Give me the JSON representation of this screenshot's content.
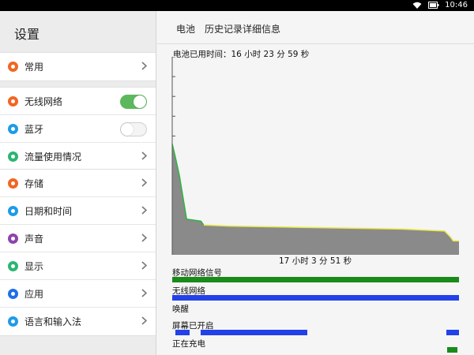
{
  "status_bar": {
    "time": "10:46",
    "icons": [
      "wifi-icon",
      "battery-icon"
    ]
  },
  "settings": {
    "title": "设置",
    "groups": [
      [
        {
          "label": "常用",
          "icon": "gear-icon",
          "color": "#f26522",
          "control": "chevron"
        }
      ],
      [
        {
          "label": "无线网络",
          "icon": "wifi-icon",
          "color": "#f26522",
          "control": "toggle",
          "state": "on"
        },
        {
          "label": "蓝牙",
          "icon": "bluetooth-icon",
          "color": "#1e9be8",
          "control": "toggle",
          "state": "off"
        },
        {
          "label": "流量使用情况",
          "icon": "data-usage-icon",
          "color": "#2bb673",
          "control": "chevron"
        }
      ],
      [
        {
          "label": "存储",
          "icon": "storage-icon",
          "color": "#f26522",
          "control": "chevron"
        },
        {
          "label": "日期和时间",
          "icon": "clock-icon",
          "color": "#1e9be8",
          "control": "chevron"
        },
        {
          "label": "声音",
          "icon": "sound-icon",
          "color": "#8e44ad",
          "control": "chevron"
        },
        {
          "label": "显示",
          "icon": "display-icon",
          "color": "#2bb673",
          "control": "chevron"
        },
        {
          "label": "应用",
          "icon": "apps-icon",
          "color": "#1e6fe8",
          "control": "chevron"
        },
        {
          "label": "语言和输入法",
          "icon": "language-icon",
          "color": "#1e9be8",
          "control": "chevron"
        }
      ]
    ]
  },
  "detail": {
    "breadcrumb_root": "电池",
    "breadcrumb_title": "历史记录详细信息",
    "battery_time_label": "电池已用时间：16 小时 23 分 59 秒",
    "total_time_label": "17 小时 3 分 51 秒",
    "rows": [
      {
        "label": "移动网络信号",
        "color": "#1a8a1a",
        "segments": [
          [
            0,
            1
          ]
        ]
      },
      {
        "label": "无线网络",
        "color": "#2341e8",
        "segments": [
          [
            0,
            1
          ]
        ]
      },
      {
        "label": "唤醒",
        "color": "#2341e8",
        "segments": []
      },
      {
        "label": "屏幕已开启",
        "color": "#2341e8",
        "segments": [
          [
            0.01,
            0.06
          ],
          [
            0.1,
            0.47
          ],
          [
            0.955,
            1
          ]
        ]
      },
      {
        "label": "正在充电",
        "color": "#1a8a1a",
        "segments": [
          [
            0.96,
            0.995
          ]
        ]
      }
    ]
  },
  "chart_data": {
    "type": "area",
    "fill": "#8a8a8a",
    "line_colors": [
      "#2bb640",
      "#e8e84a"
    ],
    "x": [
      0,
      0.01,
      0.025,
      0.05,
      0.1,
      0.11,
      0.2,
      0.4,
      0.6,
      0.8,
      0.95,
      0.97,
      0.98,
      1.0
    ],
    "y": [
      0.56,
      0.5,
      0.4,
      0.18,
      0.17,
      0.15,
      0.145,
      0.14,
      0.135,
      0.13,
      0.12,
      0.09,
      0.07,
      0.07
    ],
    "ylim": [
      0,
      1
    ]
  }
}
